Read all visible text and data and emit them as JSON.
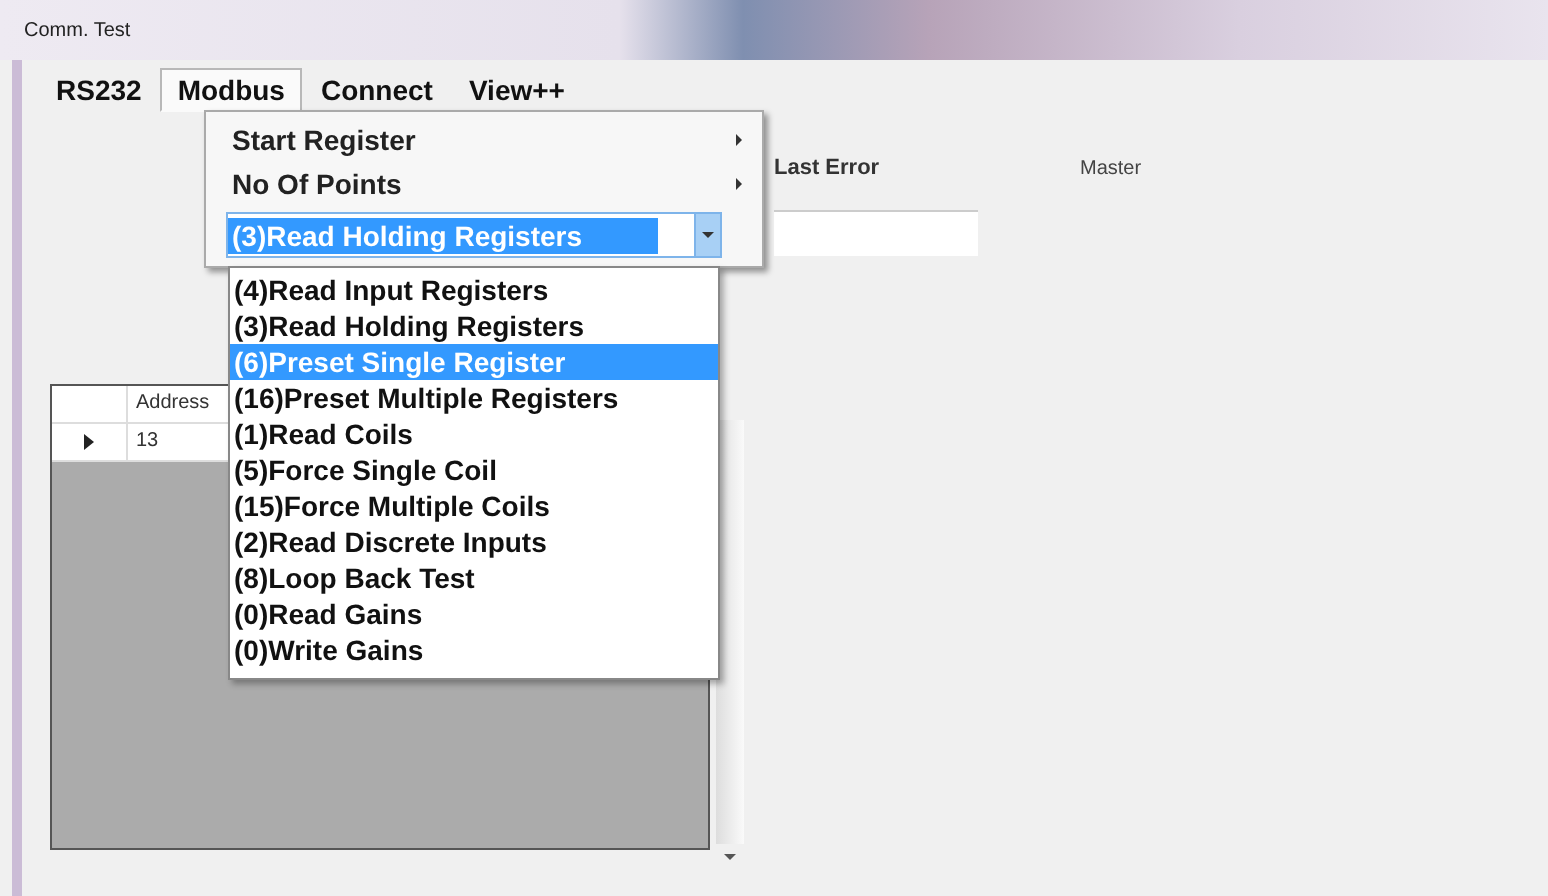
{
  "window": {
    "title": "Comm. Test"
  },
  "menu_bar": [
    {
      "label": "RS232",
      "selected": false
    },
    {
      "label": "Modbus",
      "selected": true
    },
    {
      "label": "Connect",
      "selected": false
    },
    {
      "label": "View++",
      "selected": false
    }
  ],
  "modbus_menu": {
    "items": [
      {
        "label": "Start Register",
        "has_submenu": true
      },
      {
        "label": "No Of Points",
        "has_submenu": true
      }
    ],
    "function_combo": {
      "value": "(3)Read Holding Registers",
      "expanded": true
    },
    "options": [
      {
        "label": "(4)Read Input Registers",
        "selected": false
      },
      {
        "label": "(3)Read Holding Registers",
        "selected": false
      },
      {
        "label": "(6)Preset Single Register",
        "selected": true
      },
      {
        "label": "(16)Preset Multiple Registers",
        "selected": false
      },
      {
        "label": "(1)Read Coils",
        "selected": false
      },
      {
        "label": "(5)Force Single Coil",
        "selected": false
      },
      {
        "label": "(15)Force Multiple Coils",
        "selected": false
      },
      {
        "label": "(2)Read Discrete Inputs",
        "selected": false
      },
      {
        "label": "(8)Loop Back Test",
        "selected": false
      },
      {
        "label": "(0)Read Gains",
        "selected": false
      },
      {
        "label": "(0)Write Gains",
        "selected": false
      }
    ]
  },
  "last_error": {
    "label": "Last Error"
  },
  "master_label": "Master",
  "table": {
    "columns": [
      "Address"
    ],
    "rows": [
      {
        "current": true,
        "cells": [
          "13"
        ]
      }
    ]
  }
}
